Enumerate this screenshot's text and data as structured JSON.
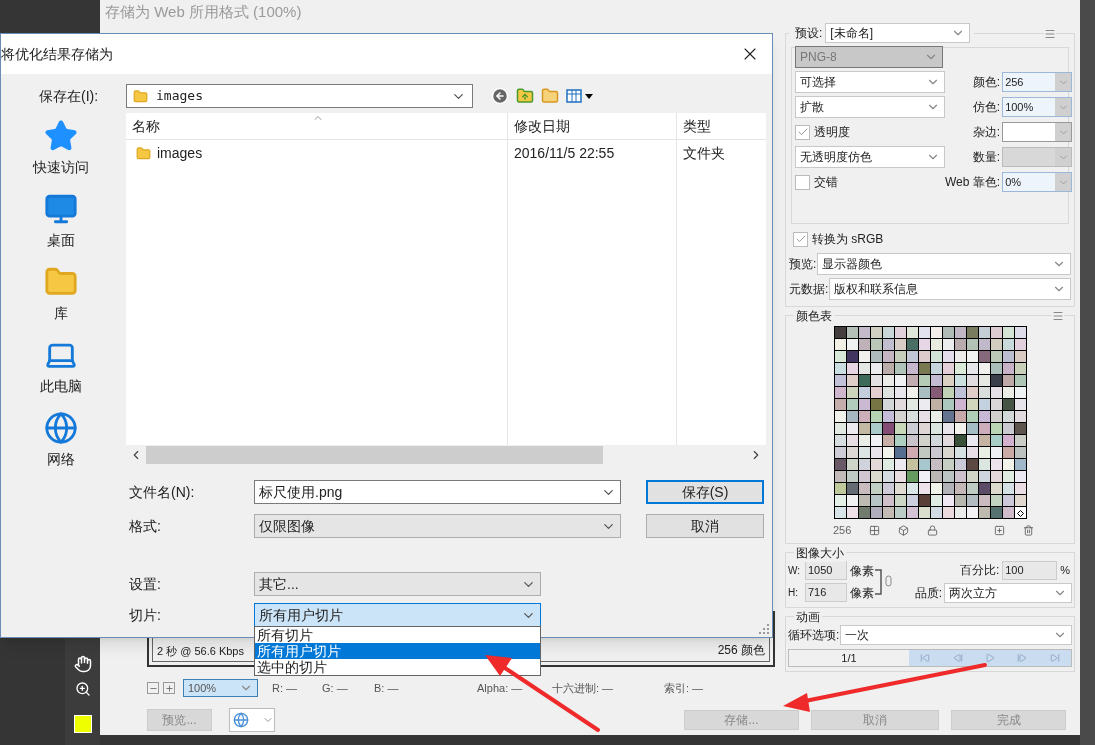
{
  "back_window": {
    "title": "存储为 Web 所用格式 (100%)"
  },
  "optimize": {
    "preset": {
      "label": "预设:",
      "value": "[未命名]"
    },
    "format": {
      "value": "PNG-8",
      "disabled": true
    },
    "left_controls": [
      {
        "kind": "select",
        "value": "可选择"
      },
      {
        "kind": "select",
        "value": "扩散"
      },
      {
        "kind": "checkbox",
        "label": "透明度",
        "checked": true
      },
      {
        "kind": "select",
        "value": "无透明度仿色"
      },
      {
        "kind": "checkbox",
        "label": "交错",
        "checked": false
      }
    ],
    "right_fields": [
      {
        "label": "颜色:",
        "value": "256",
        "kind": "combo",
        "disabled": false
      },
      {
        "label": "仿色:",
        "value": "100%",
        "kind": "combo",
        "disabled": false
      },
      {
        "label": "杂边:",
        "kind": "color"
      },
      {
        "label": "数量:",
        "kind": "combo",
        "disabled": true
      },
      {
        "label": "Web 靠色:",
        "value": "0%",
        "kind": "combo",
        "disabled": false
      }
    ],
    "srgb": {
      "label": "转换为 sRGB",
      "checked": true
    },
    "preview": {
      "label": "预览:",
      "value": "显示器颜色"
    },
    "metadata": {
      "label": "元数据:",
      "value": "版权和联系信息"
    }
  },
  "color_table": {
    "title": "颜色表",
    "count": "256"
  },
  "image_size": {
    "title": "图像大小",
    "width": {
      "label": "W:",
      "value": "1050",
      "unit": "像素"
    },
    "height": {
      "label": "H:",
      "value": "716",
      "unit": "像素"
    },
    "percent": {
      "label": "百分比:",
      "value": "100",
      "unit": "%"
    },
    "quality": {
      "label": "品质:",
      "value": "两次立方"
    }
  },
  "animation": {
    "title": "动画",
    "loop": {
      "label": "循环选项:",
      "value": "一次"
    },
    "frame": "1/1"
  },
  "status": {
    "speed": "2 秒 @ 56.6 Kbps",
    "colors": "256 颜色"
  },
  "toolbar": {
    "zoom": "100%",
    "readouts": [
      "R: —",
      "G: —",
      "B: —",
      "Alpha: —",
      "十六进制: —",
      "索引: —"
    ]
  },
  "preview_button": "预览...",
  "actions": [
    "存储...",
    "取消",
    "完成"
  ],
  "dialog": {
    "title": "将优化结果存储为",
    "save_in": {
      "label": "保存在(I):",
      "value": "images"
    },
    "places": [
      {
        "label": "快速访问",
        "kind": "quick"
      },
      {
        "label": "桌面",
        "kind": "desktop"
      },
      {
        "label": "库",
        "kind": "library"
      },
      {
        "label": "此电脑",
        "kind": "computer"
      },
      {
        "label": "网络",
        "kind": "network"
      }
    ],
    "columns": [
      "名称",
      "修改日期",
      "类型"
    ],
    "rows": [
      {
        "cells": [
          "images",
          "2016/11/5 22:55",
          "文件夹"
        ]
      }
    ],
    "fields": [
      {
        "label": "文件名(N):",
        "value": "标尺使用.png",
        "kind": "text"
      },
      {
        "label": "格式:",
        "value": "仅限图像",
        "kind": "combo"
      }
    ],
    "buttons": [
      {
        "label": "保存(S)",
        "default": true
      },
      {
        "label": "取消",
        "default": false
      }
    ],
    "settings": {
      "label": "设置:",
      "value": "其它..."
    },
    "slices": {
      "label": "切片:",
      "value": "所有用户切片",
      "open": true,
      "options": [
        {
          "label": "所有切片",
          "selected": false
        },
        {
          "label": "所有用户切片",
          "selected": true
        },
        {
          "label": "选中的切片",
          "selected": false
        }
      ]
    }
  }
}
